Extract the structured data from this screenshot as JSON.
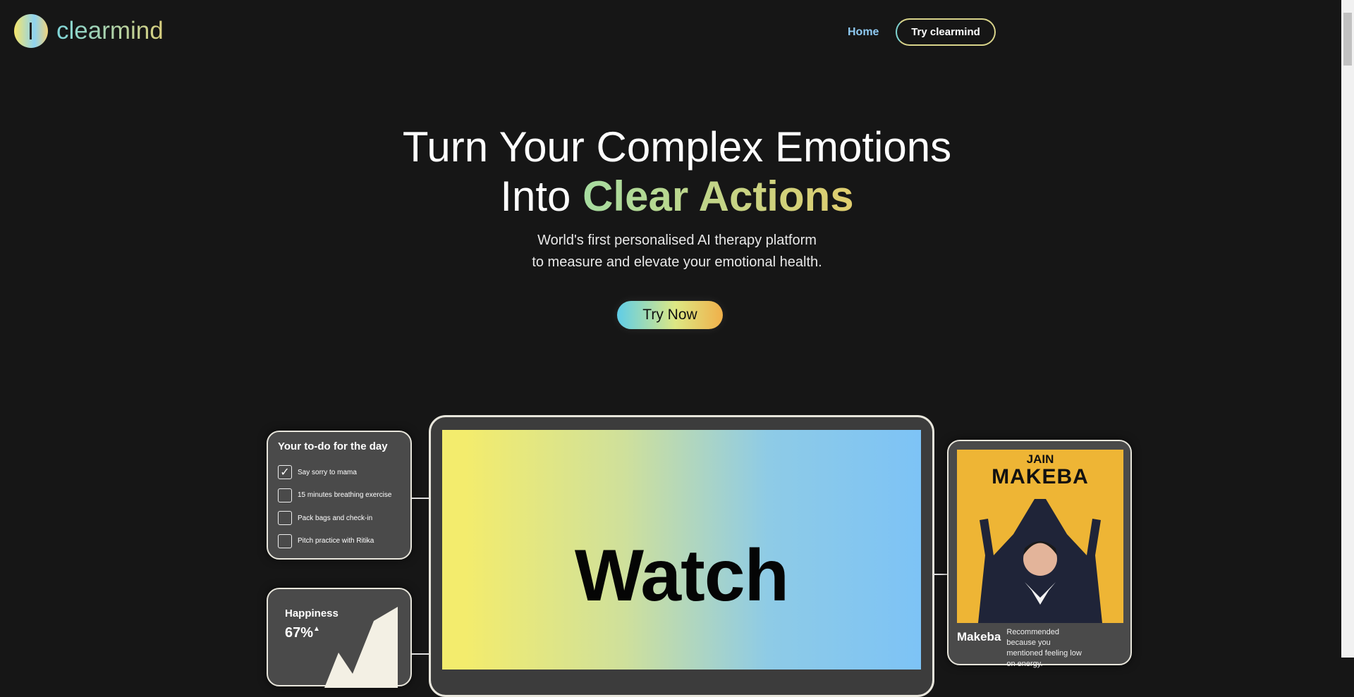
{
  "nav": {
    "brand": "clearmind",
    "home": "Home",
    "cta": "Try clearmind"
  },
  "hero": {
    "title_line1": "Turn Your Complex Emotions",
    "title_line2_plain": "Into ",
    "title_line2_highlight": "Clear Actions",
    "subtitle_line1": "World's first personalised AI therapy platform",
    "subtitle_line2": "to measure and elevate your emotional health.",
    "button": "Try Now"
  },
  "todo": {
    "title": "Your to-do for the day",
    "items": [
      {
        "label": "Say sorry to mama",
        "checked": true
      },
      {
        "label": "15 minutes breathing exercise",
        "checked": false
      },
      {
        "label": "Pack bags and check-in",
        "checked": false
      },
      {
        "label": "Pitch practice with Ritika",
        "checked": false
      }
    ]
  },
  "happiness": {
    "label": "Happiness",
    "value": "67%",
    "trend": "up"
  },
  "video": {
    "label": "Watch"
  },
  "recommendation": {
    "poster_line1": "JAIN",
    "poster_line2": "MAKEBA",
    "title": "Makeba",
    "description": "Recommended because you mentioned feeling low on energy."
  },
  "colors": {
    "background": "#161616",
    "card": "#4a4a4a",
    "accent_green": "#a6dca0",
    "accent_yellow": "#e0cd6e",
    "accent_blue": "#8fcaf2"
  }
}
